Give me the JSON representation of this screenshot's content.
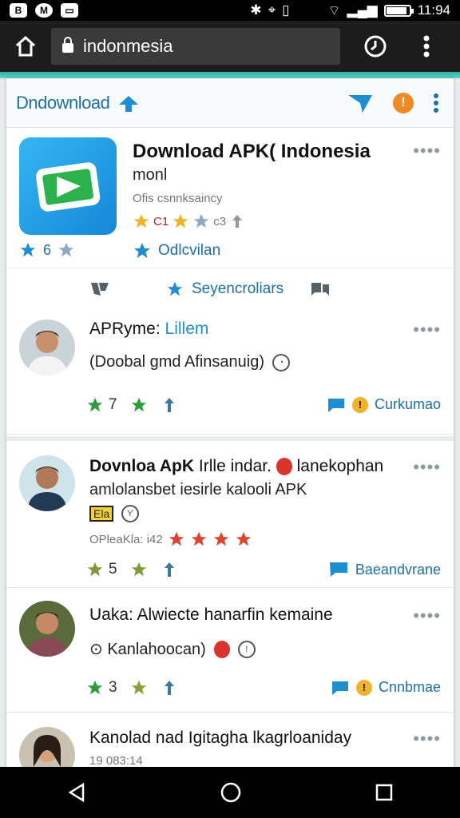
{
  "status": {
    "left_icons": [
      "B",
      "M",
      "▭"
    ],
    "time": "11:94"
  },
  "browser": {
    "url": "indonmesia"
  },
  "app": {
    "title": "Dndownload"
  },
  "featured": {
    "title": "Download APK( Indonesia",
    "subtitle": "monl",
    "meta": "Ofis csnnksaincy",
    "rating_a": "C1",
    "rating_b": "c3",
    "link": "Odlcvilan",
    "stars_count": "6",
    "tab_label": "Seyencroliars"
  },
  "posts": [
    {
      "title_a": "APRyme:",
      "title_b": "Lillem",
      "line": "(Doobal gmd Afinsanuig)",
      "stars": "7",
      "right": "Curkumao",
      "avatar_colors": [
        "#c9d3d8",
        "#3d2a22",
        "#f4f4f4"
      ]
    },
    {
      "title_a": "Dovnloa ApK",
      "title_b": "Irlle indar.",
      "title_c": "lanekophan",
      "line2": "amlolansbet iesirle kalooli APK",
      "meta": "OPleaKla: i42",
      "badge": "Ela",
      "stars": "5",
      "right": "Baeandvrane",
      "avatar_colors": [
        "#cfe3ea",
        "#3a2c24",
        "#233a55"
      ]
    },
    {
      "title": "Uaka: Alwiecte hanarfin kemaine",
      "line": "⊙ Kanlahoocan)",
      "stars": "3",
      "right": "Cnnbmae",
      "avatar_colors": [
        "#5b6a3b",
        "#3e2b20",
        "#8a4a55"
      ]
    },
    {
      "title": "Kanolad nad Igitagha lkagrloaniday",
      "meta": "19 083:14"
    }
  ],
  "colors": {
    "accent": "#2ab1a8",
    "brand_blue": "#1d6fa6",
    "star_green": "#2a9d3c",
    "star_red": "#e0432e",
    "star_gold": "#f2b22b"
  }
}
